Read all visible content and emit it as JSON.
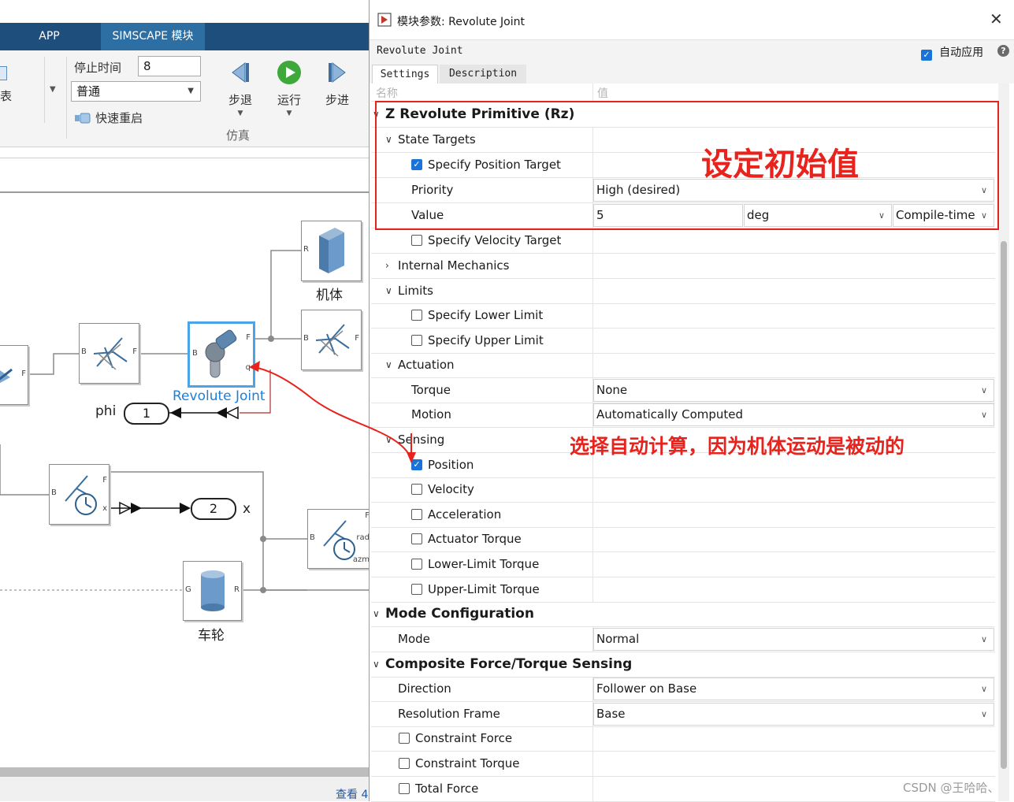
{
  "ribbon": {
    "tabs": [
      "APP",
      "SIMSCAPE 模块"
    ],
    "partial_table_label": "列表",
    "stop_time_label": "停止时间",
    "stop_time_value": "8",
    "mode_value": "普通",
    "fast_restart": "快速重启",
    "step_back": "步退",
    "run": "运行",
    "step_forward": "步进",
    "group_label": "仿真"
  },
  "model": {
    "block_body": "机体",
    "block_joint": "Revolute Joint",
    "block_wheel": "车轮",
    "goto_phi_label": "phi",
    "goto_phi_num": "1",
    "goto_x_num": "2",
    "goto_x_label": "x",
    "status_partial": "查看 4"
  },
  "dialog": {
    "title": "模块参数: Revolute Joint",
    "block_name": "Revolute Joint",
    "auto_apply_label": "自动应用",
    "tabs": [
      "Settings",
      "Description"
    ],
    "col_name": "名称",
    "col_value": "值",
    "rows": [
      {
        "label": "Z Revolute Primitive (Rz)"
      },
      {
        "label": "State Targets"
      },
      {
        "label": "Specify Position Target"
      },
      {
        "label": "Priority",
        "value": "High (desired)"
      },
      {
        "label": "Value",
        "value": "5",
        "unit": "deg",
        "config": "Compile-time"
      },
      {
        "label": "Specify Velocity Target"
      },
      {
        "label": "Internal Mechanics"
      },
      {
        "label": "Limits"
      },
      {
        "label": "Specify Lower Limit"
      },
      {
        "label": "Specify Upper Limit"
      },
      {
        "label": "Actuation"
      },
      {
        "label": "Torque",
        "value": "None"
      },
      {
        "label": "Motion",
        "value": "Automatically Computed"
      },
      {
        "label": "Sensing"
      },
      {
        "label": "Position"
      },
      {
        "label": "Velocity"
      },
      {
        "label": "Acceleration"
      },
      {
        "label": "Actuator Torque"
      },
      {
        "label": "Lower-Limit Torque"
      },
      {
        "label": "Upper-Limit Torque"
      },
      {
        "label": "Mode Configuration"
      },
      {
        "label": "Mode",
        "value": "Normal"
      },
      {
        "label": "Composite Force/Torque Sensing"
      },
      {
        "label": "Direction",
        "value": "Follower on Base"
      },
      {
        "label": "Resolution Frame",
        "value": "Base"
      },
      {
        "label": "Constraint Force"
      },
      {
        "label": "Constraint Torque"
      },
      {
        "label": "Total Force"
      }
    ]
  },
  "annotations": {
    "initial_value": "设定初始值",
    "auto_compute": "选择自动计算，因为机体运动是被动的",
    "color": "#e8231d"
  },
  "watermark": "CSDN @王哈哈、",
  "colors": {
    "ribbon_tab_bg": "#1e4f7c",
    "selected_tab_bg": "#2d6ea3",
    "checkbox_blue": "#1a73d9",
    "selected_block": "#4ba3e8"
  }
}
